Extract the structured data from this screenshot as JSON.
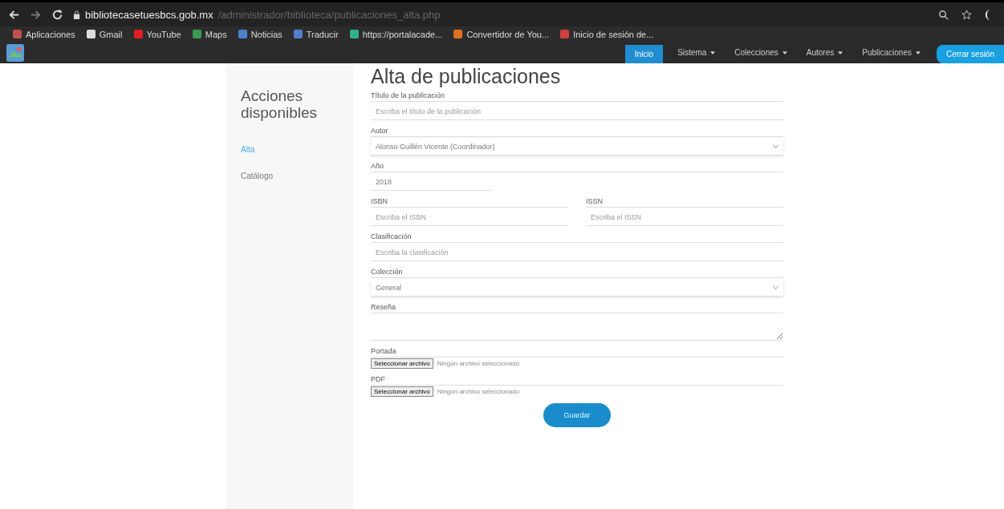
{
  "browser": {
    "url_host": "bibliotecasetuesbcs.gob.mx",
    "url_path": "/administrador/biblioteca/publicaciones_alta.php",
    "bookmarks": [
      {
        "label": "Aplicaciones",
        "color": "#c0504d"
      },
      {
        "label": "Gmail",
        "color": "#dddddd"
      },
      {
        "label": "YouTube",
        "color": "#e02020"
      },
      {
        "label": "Maps",
        "color": "#3a9a50"
      },
      {
        "label": "Noticias",
        "color": "#4a80d0"
      },
      {
        "label": "Traducir",
        "color": "#5080c8"
      },
      {
        "label": "https://portalacade...",
        "color": "#30b090"
      },
      {
        "label": "Convertidor de You...",
        "color": "#e07020"
      },
      {
        "label": "Inicio de sesión de...",
        "color": "#d04040"
      }
    ]
  },
  "nav": {
    "items": [
      {
        "label": "Inicio",
        "selected": true,
        "dropdown": false
      },
      {
        "label": "Sistema",
        "selected": false,
        "dropdown": true
      },
      {
        "label": "Colecciones",
        "selected": false,
        "dropdown": true
      },
      {
        "label": "Autores",
        "selected": false,
        "dropdown": true
      },
      {
        "label": "Publicaciones",
        "selected": false,
        "dropdown": true
      }
    ],
    "logout": "Cerrar sesión"
  },
  "sidebar": {
    "title": "Acciones disponibles",
    "items": [
      {
        "label": "Alta",
        "selected": true
      },
      {
        "label": "Catálogo",
        "selected": false
      }
    ]
  },
  "form": {
    "title": "Alta de publicaciones",
    "rows": [
      [
        {
          "kind": "text",
          "label": "Título de la publicación",
          "placeholder": "Escriba el título de la publicación"
        }
      ],
      [
        {
          "kind": "select",
          "label": "Autor",
          "value": "Alonso Guillén Vicente (Coordinador)"
        }
      ],
      [
        {
          "kind": "short",
          "label": "Año",
          "value": "2018"
        }
      ],
      [
        {
          "kind": "text",
          "label": "ISBN",
          "placeholder": "Escriba el ISBN"
        },
        {
          "kind": "text",
          "label": "ISSN",
          "placeholder": "Escriba el ISSN"
        }
      ],
      [
        {
          "kind": "text",
          "label": "Clasificación",
          "placeholder": "Escriba la clasificación"
        }
      ],
      [
        {
          "kind": "select",
          "label": "Colección",
          "value": "General"
        }
      ],
      [
        {
          "kind": "textarea",
          "label": "Reseña"
        }
      ],
      [
        {
          "kind": "file",
          "label": "Portada",
          "button": "Seleccionar archivo",
          "status": "Ningún archivo seleccionado"
        }
      ],
      [
        {
          "kind": "file",
          "label": "PDF",
          "button": "Seleccionar archivo",
          "status": "Ningún archivo seleccionado"
        }
      ]
    ],
    "submit": "Guardar"
  }
}
